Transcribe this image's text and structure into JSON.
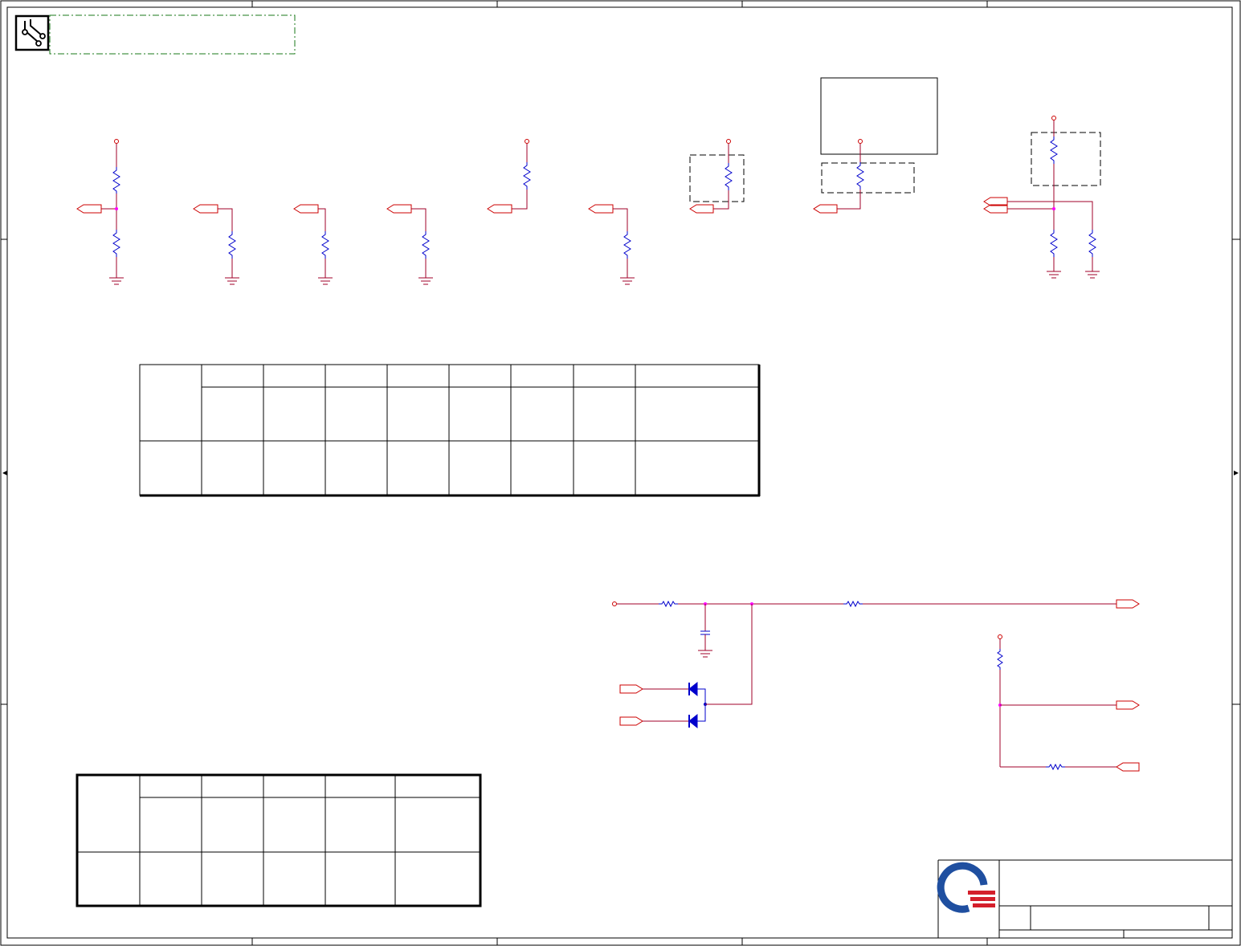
{
  "sheet": {
    "title": "",
    "colors": {
      "border": "#000000",
      "wire": "#a0002a",
      "port": "#cc0000",
      "power": "#cc0000",
      "resistor": "#0000cc",
      "diode": "#0000cc",
      "junction": "#ff00ff",
      "frame_dash": "#1a7a1a",
      "logo_blue": "#1f4fa0",
      "logo_red": "#d41f2b"
    },
    "icons": [
      "pcb-trace-icon",
      "company-logo-icon"
    ]
  },
  "tables": {
    "strap_table": {
      "rows": 3,
      "label_columns": 1,
      "value_columns": 8
    },
    "id_table": {
      "rows": 3,
      "label_columns": 1,
      "value_columns": 5
    }
  }
}
